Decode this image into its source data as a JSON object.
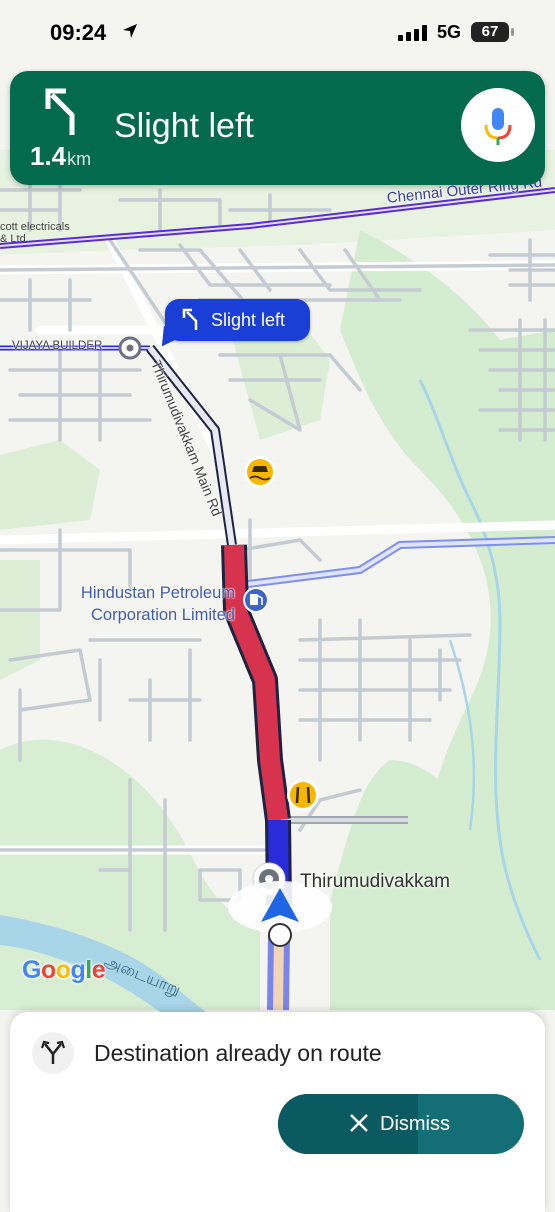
{
  "status_bar": {
    "time": "09:24",
    "network": "5G",
    "battery": "67"
  },
  "nav": {
    "instruction": "Slight left",
    "distance": "1.4",
    "distance_unit": "km"
  },
  "map": {
    "callout": "Slight left",
    "labels": {
      "outer_ring": "Chennai Outer Ring Rd",
      "electricals_1": "cott electricals",
      "electricals_2": "& Ltd",
      "vijaya": "VIJAYA BUILDER",
      "main_rd": "Thirumudivakkam Main Rd",
      "hp_1": "Hindustan Petroleum",
      "hp_2": "Corporation Limited",
      "locality": "Thirumudivakkam",
      "river": "அடையாறு"
    },
    "logo": "Google"
  },
  "sheet": {
    "message": "Destination already on route",
    "dismiss_label": "Dismiss"
  },
  "colors": {
    "banner": "#046a4e",
    "route": "#2a2bd9",
    "traffic": "#d7334f",
    "dismiss": "#136e75"
  }
}
